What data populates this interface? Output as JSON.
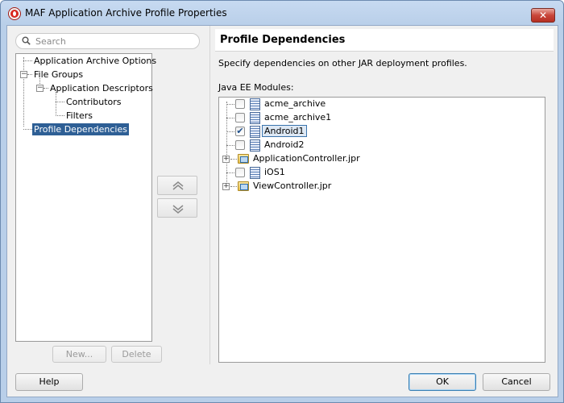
{
  "window": {
    "title": "MAF Application Archive Profile Properties",
    "close_glyph": "✕"
  },
  "search": {
    "placeholder": "Search",
    "icon": "search-icon"
  },
  "nav_tree": {
    "items": [
      {
        "label": "Application Archive Options"
      },
      {
        "label": "File Groups"
      },
      {
        "label": "Application Descriptors"
      },
      {
        "label": "Contributors"
      },
      {
        "label": "Filters"
      },
      {
        "label": "Profile Dependencies",
        "selected": true
      }
    ],
    "expander_minus": "−"
  },
  "left_buttons": {
    "new_label": "New...",
    "delete_label": "Delete"
  },
  "move_buttons": {
    "up_icon": "double-chevron-up-icon",
    "down_icon": "double-chevron-down-icon"
  },
  "main": {
    "title": "Profile Dependencies",
    "description": "Specify dependencies on other JAR deployment profiles.",
    "modules_label": "Java EE Modules:"
  },
  "modules": [
    {
      "label": "acme_archive",
      "type": "file",
      "checked": false
    },
    {
      "label": "acme_archive1",
      "type": "file",
      "checked": false
    },
    {
      "label": "Android1",
      "type": "file",
      "checked": true,
      "selected": true
    },
    {
      "label": "Android2",
      "type": "file",
      "checked": false
    },
    {
      "label": "ApplicationController.jpr",
      "type": "project",
      "expandable": true
    },
    {
      "label": "iOS1",
      "type": "file",
      "checked": false
    },
    {
      "label": "ViewController.jpr",
      "type": "project",
      "expandable": true
    }
  ],
  "check_glyph": "✔",
  "expander_plus": "+",
  "footer": {
    "help_label": "Help",
    "ok_label": "OK",
    "cancel_label": "Cancel"
  },
  "colors": {
    "selection": "#2e5f95",
    "title_bar": "#b9cfe9",
    "close_button": "#c9463a"
  }
}
